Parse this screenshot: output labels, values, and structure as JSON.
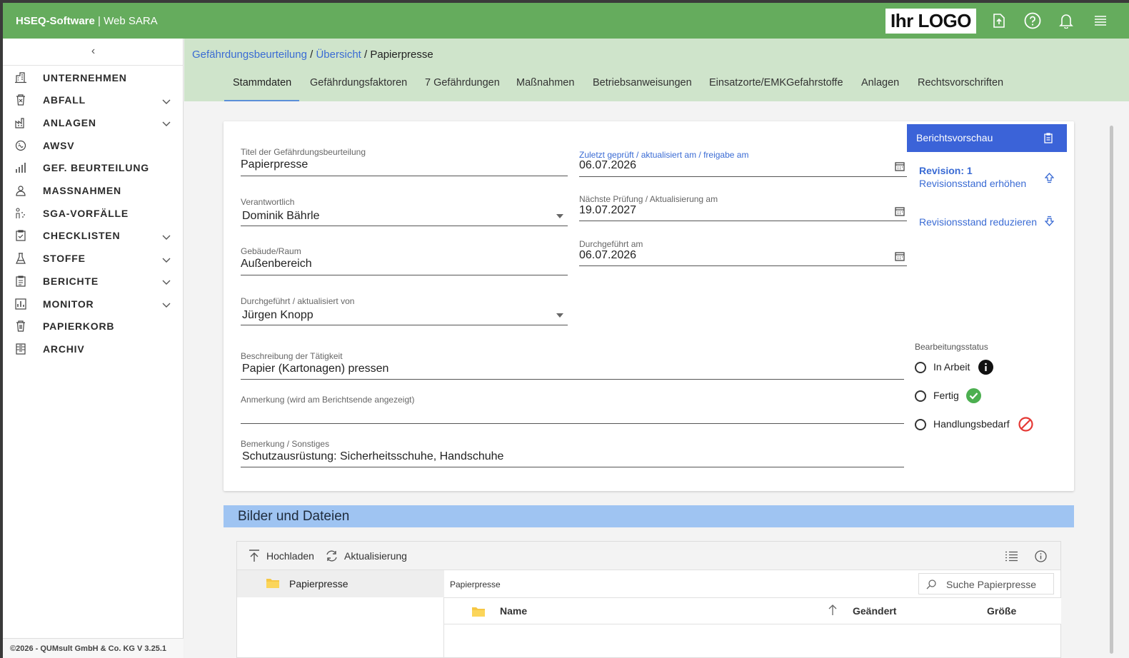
{
  "app": {
    "brand_bold": "HSEQ-Software",
    "separator": " | ",
    "brand_name": "Web SARA",
    "logo_text": "Ihr LOGO"
  },
  "topbar_icons": [
    "upload-file-icon",
    "help-icon",
    "bell-icon",
    "menu-icon"
  ],
  "sidebar": {
    "collapse_glyph": "‹",
    "items": [
      {
        "label": "UNTERNEHMEN",
        "icon": "building-icon",
        "expandable": false
      },
      {
        "label": "ABFALL",
        "icon": "waste-bin-icon",
        "expandable": true
      },
      {
        "label": "ANLAGEN",
        "icon": "factory-icon",
        "expandable": true
      },
      {
        "label": "AWSV",
        "icon": "water-icon",
        "expandable": false
      },
      {
        "label": "GEF. BEURTEILUNG",
        "icon": "assessment-chart-icon",
        "expandable": false
      },
      {
        "label": "MASSNAHMEN",
        "icon": "measures-icon",
        "expandable": false
      },
      {
        "label": "SGA-VORFÄLLE",
        "icon": "incident-icon",
        "expandable": false
      },
      {
        "label": "CHECKLISTEN",
        "icon": "clipboard-check-icon",
        "expandable": true
      },
      {
        "label": "STOFFE",
        "icon": "flask-icon",
        "expandable": true
      },
      {
        "label": "BERICHTE",
        "icon": "report-icon",
        "expandable": true
      },
      {
        "label": "MONITOR",
        "icon": "monitor-icon",
        "expandable": true
      },
      {
        "label": "PAPIERKORB",
        "icon": "trash-icon",
        "expandable": false
      },
      {
        "label": "ARCHIV",
        "icon": "archive-icon",
        "expandable": false
      }
    ],
    "footer": "©2026 - QUMsult GmbH & Co. KG    V 3.25.1"
  },
  "breadcrumb": {
    "part1": "Gefährdungsbeurteilung",
    "sep1": " / ",
    "part2": "Übersicht",
    "sep2": " / ",
    "current": "Papierpresse"
  },
  "tabs": [
    "Stammdaten",
    "Gefährdungsfaktoren",
    "7 Gefährdungen",
    "Maßnahmen",
    "Betriebsanweisungen",
    "Einsatzorte/EMKGefahrstoffe",
    "Anlagen",
    "Rechtsvorschriften"
  ],
  "form": {
    "title_label": "Titel der Gefährdungsbeurteilung",
    "title_value": "Papierpresse",
    "responsible_label": "Verantwortlich",
    "responsible_value": "Dominik Bährle",
    "building_label": "Gebäude/Raum",
    "building_value": "Außenbereich",
    "executed_by_label": "Durchgeführt / aktualisiert von",
    "executed_by_value": "Jürgen Knopp",
    "last_checked_label": "Zuletzt geprüft / aktualisiert am / freigabe am",
    "last_checked_value": "06.07.2026",
    "next_check_label": "Nächste Prüfung / Aktualisierung am",
    "next_check_value": "19.07.2027",
    "executed_on_label": "Durchgeführt am",
    "executed_on_value": "06.07.2026",
    "description_label": "Beschreibung der Tätigkeit",
    "description_value": "Papier (Kartonagen) pressen",
    "annotation_label": "Anmerkung (wird am Berichtsende angezeigt)",
    "annotation_value": "",
    "remark_label": "Bemerkung / Sonstiges",
    "remark_value": "Schutzausrüstung: Sicherheitsschuhe, Handschuhe"
  },
  "side_panel": {
    "report_button": "Berichtsvorschau",
    "revision": "Revision: 1",
    "increase": "Revisionsstand erhöhen",
    "decrease": "Revisionsstand reduzieren"
  },
  "status": {
    "label": "Bearbeitungsstatus",
    "options": [
      {
        "label": "In Arbeit",
        "icon": "info-icon",
        "color": "#111111"
      },
      {
        "label": "Fertig",
        "icon": "check-circle-icon",
        "color": "#4caf50"
      },
      {
        "label": "Handlungsbedarf",
        "icon": "blocked-icon",
        "color": "#e53935"
      }
    ],
    "selected": null
  },
  "files": {
    "section_title": "Bilder und Dateien",
    "upload": "Hochladen",
    "refresh": "Aktualisierung",
    "tree_folder": "Papierpresse",
    "current_path": "Papierpresse",
    "search_placeholder": "Suche Papierpresse",
    "columns": [
      "Name",
      "Geändert",
      "Größe"
    ]
  },
  "colors": {
    "topbar": "#65ac5d",
    "tabbar": "#cfe4cb",
    "accent": "#3b63d8",
    "files_header": "#9fc4f2"
  }
}
